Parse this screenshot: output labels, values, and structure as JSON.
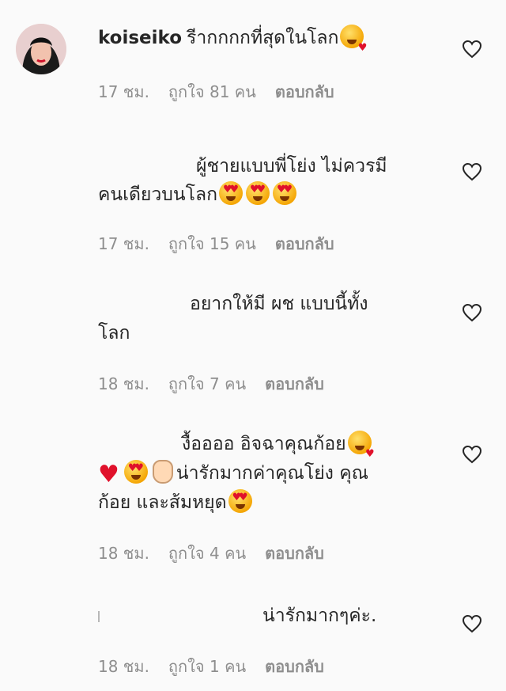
{
  "colors": {
    "text": "#262626",
    "meta": "#8e8e8e",
    "background": "#fafafa",
    "heart_red": "#e0112b"
  },
  "comments": [
    {
      "username": "koiseiko",
      "text": "รีากกกกที่สุดในโลก",
      "time": "17 ชม.",
      "likes": "ถูกใจ 81 คน",
      "reply": "ตอบกลับ"
    },
    {
      "line1": "ผู้ชายแบบพี่โย่ง ไม่ควรมี",
      "line2": "คนเดียวบนโลก",
      "time": "17 ชม.",
      "likes": "ถูกใจ 15 คน",
      "reply": "ตอบกลับ"
    },
    {
      "line1": "อยากให้มี ผช แบบนี้ทั้ง",
      "line2": "โลก",
      "time": "18 ชม.",
      "likes": "ถูกใจ 7 คน",
      "reply": "ตอบกลับ"
    },
    {
      "line1": "งื้ออออ อิจฉาคุณก้อย",
      "line2": "น่ารักมากค่าคุณโย่ง คุณ",
      "line3": "ก้อย และส้มหยุด",
      "time": "18 ชม.",
      "likes": "ถูกใจ 4 คน",
      "reply": "ตอบกลับ"
    },
    {
      "text": "น่ารักมากๆค่ะ.",
      "time": "18 ชม.",
      "likes": "ถูกใจ 1 คน",
      "reply": "ตอบกลับ"
    }
  ],
  "icons": {
    "like": "heart-outline-icon",
    "avatar": "avatar"
  }
}
